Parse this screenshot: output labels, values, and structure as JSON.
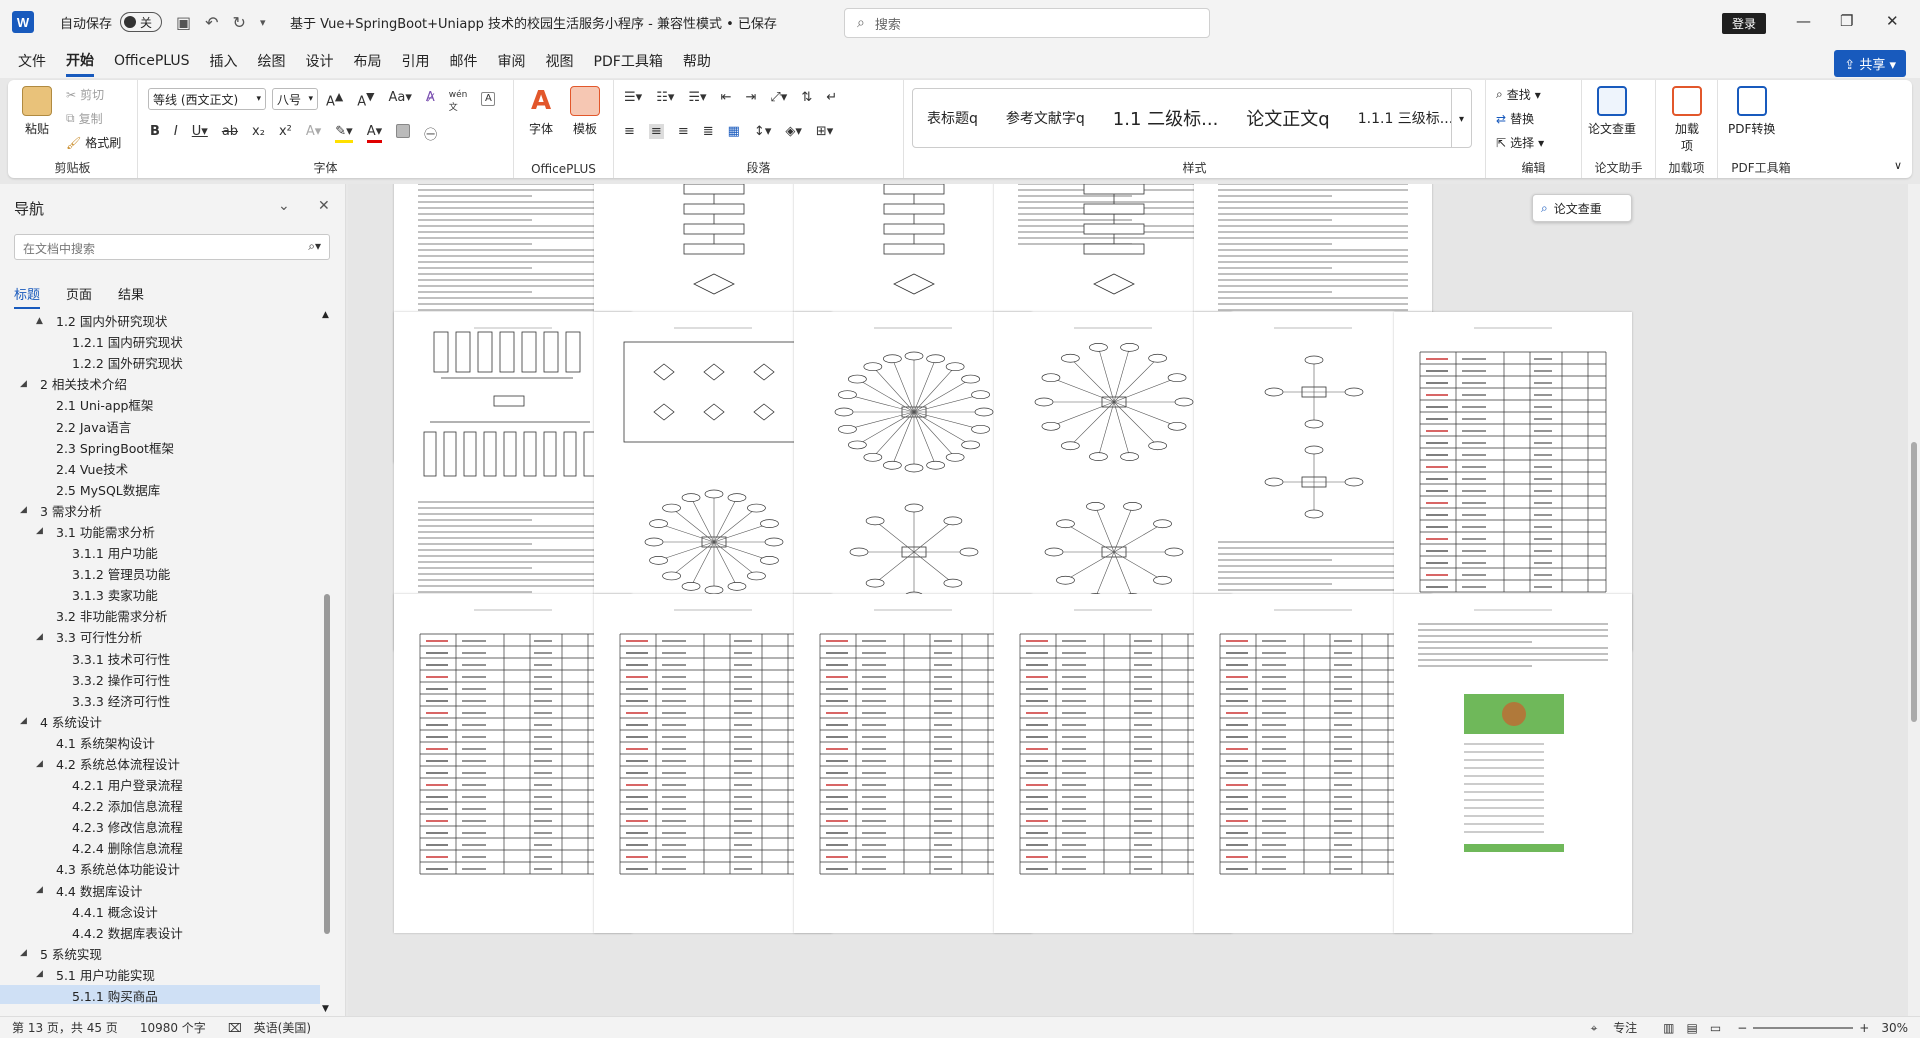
{
  "titlebar": {
    "app_logo": "W",
    "autosave_label": "自动保存",
    "autosave_state": "关",
    "doc_title": "基于 Vue+SpringBoot+Uniapp 技术的校园生活服务小程序  -  兼容性模式 • 已保存",
    "search_placeholder": "搜索",
    "login_label": "登录"
  },
  "menu": {
    "tabs": [
      "文件",
      "开始",
      "OfficePLUS",
      "插入",
      "绘图",
      "设计",
      "布局",
      "引用",
      "邮件",
      "审阅",
      "视图",
      "PDF工具箱",
      "帮助"
    ],
    "active_tab": "开始",
    "share_label": "共享"
  },
  "ribbon": {
    "clipboard": {
      "paste": "粘贴",
      "cut": "剪切",
      "copy": "复制",
      "format_painter": "格式刷",
      "label": "剪贴板"
    },
    "font": {
      "font_name": "等线 (西文正文)",
      "font_size": "八号",
      "label": "字体"
    },
    "officeplus": {
      "font_btn": "字体",
      "template_btn": "模板",
      "label": "OfficePLUS"
    },
    "paragraph": {
      "label": "段落"
    },
    "styles": {
      "items": [
        "表标题q",
        "参考文献字q",
        "1.1  二级标...",
        "论文正文q",
        "1.1.1  三级标..."
      ],
      "label": "样式"
    },
    "editing": {
      "find": "查找",
      "replace": "替换",
      "select": "选择",
      "label": "编辑"
    },
    "paper_check": {
      "button": "论文查重",
      "label": "论文助手"
    },
    "addins": {
      "button": "加载项",
      "label": "加载项"
    },
    "pdf": {
      "button": "PDF转换",
      "label": "PDF工具箱"
    }
  },
  "nav": {
    "title": "导航",
    "search_placeholder": "在文档中搜索",
    "tabs": [
      "标题",
      "页面",
      "结果"
    ],
    "active_tab": "标题",
    "items": [
      {
        "label": "1.2 国内外研究现状",
        "level": 1,
        "caret": "▲"
      },
      {
        "label": "1.2.1 国内研究现状",
        "level": 2,
        "caret": ""
      },
      {
        "label": "1.2.2 国外研究现状",
        "level": 2,
        "caret": ""
      },
      {
        "label": "2 相关技术介绍",
        "level": 0,
        "caret": "◢"
      },
      {
        "label": "2.1 Uni-app框架",
        "level": 1,
        "caret": ""
      },
      {
        "label": "2.2  Java语言",
        "level": 1,
        "caret": ""
      },
      {
        "label": "2.3  SpringBoot框架",
        "level": 1,
        "caret": ""
      },
      {
        "label": "2.4  Vue技术",
        "level": 1,
        "caret": ""
      },
      {
        "label": "2.5  MySQL数据库",
        "level": 1,
        "caret": ""
      },
      {
        "label": "3 需求分析",
        "level": 0,
        "caret": "◢"
      },
      {
        "label": "3.1 功能需求分析",
        "level": 1,
        "caret": "◢"
      },
      {
        "label": "3.1.1 用户功能",
        "level": 2,
        "caret": ""
      },
      {
        "label": "3.1.2 管理员功能",
        "level": 2,
        "caret": ""
      },
      {
        "label": "3.1.3 卖家功能",
        "level": 2,
        "caret": ""
      },
      {
        "label": "3.2 非功能需求分析",
        "level": 1,
        "caret": ""
      },
      {
        "label": "3.3 可行性分析",
        "level": 1,
        "caret": "◢"
      },
      {
        "label": "3.3.1 技术可行性",
        "level": 2,
        "caret": ""
      },
      {
        "label": "3.3.2 操作可行性",
        "level": 2,
        "caret": ""
      },
      {
        "label": "3.3.3 经济可行性",
        "level": 2,
        "caret": ""
      },
      {
        "label": "4 系统设计",
        "level": 0,
        "caret": "◢"
      },
      {
        "label": "4.1 系统架构设计",
        "level": 1,
        "caret": ""
      },
      {
        "label": "4.2 系统总体流程设计",
        "level": 1,
        "caret": "◢"
      },
      {
        "label": "4.2.1 用户登录流程",
        "level": 2,
        "caret": ""
      },
      {
        "label": "4.2.2 添加信息流程",
        "level": 2,
        "caret": ""
      },
      {
        "label": "4.2.3 修改信息流程",
        "level": 2,
        "caret": ""
      },
      {
        "label": "4.2.4 删除信息流程",
        "level": 2,
        "caret": ""
      },
      {
        "label": "4.3 系统总体功能设计",
        "level": 1,
        "caret": ""
      },
      {
        "label": "4.4 数据库设计",
        "level": 1,
        "caret": "◢"
      },
      {
        "label": "4.4.1 概念设计",
        "level": 2,
        "caret": ""
      },
      {
        "label": "4.4.2 数据库表设计",
        "level": 2,
        "caret": ""
      },
      {
        "label": "5 系统实现",
        "level": 0,
        "caret": "◢"
      },
      {
        "label": "5.1 用户功能实现",
        "level": 1,
        "caret": "◢"
      },
      {
        "label": "5.1.1 购买商品",
        "level": 2,
        "caret": "",
        "selected": true
      }
    ]
  },
  "document": {
    "tooltip_label": "论文查重",
    "page_rows": [
      [
        "text",
        "flow",
        "flowchart",
        "text-flow",
        "text"
      ],
      [
        "tree",
        "er-flow",
        "star-er",
        "star-er2",
        "star-er3",
        "table"
      ],
      [
        "table",
        "table",
        "table",
        "table",
        "table",
        "screenshot"
      ]
    ]
  },
  "status": {
    "page": "第 13 页，共 45 页",
    "words": "10980 个字",
    "language": "英语(美国)",
    "focus": "专注",
    "zoom": "30%"
  }
}
